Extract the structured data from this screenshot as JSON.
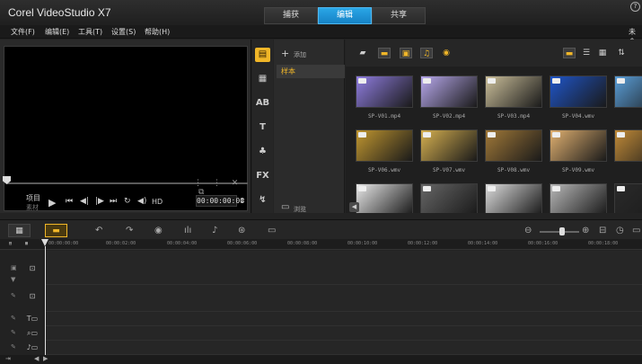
{
  "app": {
    "title": "Corel VideoStudio X7"
  },
  "mode_tabs": [
    {
      "label": "捕获",
      "active": false
    },
    {
      "label": "编辑",
      "active": true
    },
    {
      "label": "共享",
      "active": false
    }
  ],
  "menu": {
    "items": [
      "文件(F)",
      "编辑(E)",
      "工具(T)",
      "设置(S)",
      "帮助(H)"
    ],
    "right_label": "未命"
  },
  "player": {
    "project_label": "项目",
    "clip_label": "素材",
    "hd_label": "HD",
    "timecode": "00:00:00:00",
    "controls": [
      "play-icon",
      "home-icon",
      "prev-frame-icon",
      "next-frame-icon",
      "end-icon",
      "repeat-icon",
      "volume-icon"
    ]
  },
  "library": {
    "add_label": "添加",
    "browse_label": "浏览",
    "folders": [
      {
        "label": "样本",
        "selected": true
      }
    ],
    "side_tools": [
      "media-icon",
      "instant-project-icon",
      "transition-icon",
      "title-icon",
      "graphic-icon",
      "filter-icon",
      "path-icon"
    ],
    "toolbar_icons": [
      "folder-icon",
      "show-videos-icon",
      "show-photos-icon",
      "show-audio-icon",
      "show-effects-icon"
    ],
    "view_icons": [
      "thumbnail-view-icon",
      "list-view-icon",
      "grid-view-icon",
      "options-icon"
    ],
    "thumbnails": [
      {
        "caption": "SP-V01.mp4",
        "color": "#8f7de0"
      },
      {
        "caption": "SP-V02.mp4",
        "color": "#b7a8ec"
      },
      {
        "caption": "SP-V03.mp4",
        "color": "#cbbf9a"
      },
      {
        "caption": "SP-V04.wmv",
        "color": "#1f55c8"
      },
      {
        "caption": "",
        "color": "#5a9ed8"
      },
      {
        "caption": "SP-V06.wmv",
        "color": "#c09630"
      },
      {
        "caption": "SP-V07.wmv",
        "color": "#d6b050"
      },
      {
        "caption": "SP-V08.wmv",
        "color": "#a07838"
      },
      {
        "caption": "SP-V09.wmv",
        "color": "#e0b070"
      },
      {
        "caption": "",
        "color": "#c08a38"
      },
      {
        "caption": "",
        "color": "#e8e8e8"
      },
      {
        "caption": "",
        "color": "#666666"
      },
      {
        "caption": "",
        "color": "#dcdcdc"
      },
      {
        "caption": "",
        "color": "#b8b8b8"
      },
      {
        "caption": "",
        "color": "#2a2a2a"
      }
    ]
  },
  "timeline": {
    "view_buttons": [
      {
        "icon": "storyboard-view-icon",
        "active": false
      },
      {
        "icon": "timeline-view-icon",
        "active": true
      }
    ],
    "tools": [
      "undo-icon",
      "redo-icon",
      "record-capture-icon",
      "sound-mixer-icon",
      "auto-music-icon",
      "motion-tracking-icon",
      "subtitle-editor-icon"
    ],
    "right_tools": [
      "zoom-out-icon",
      "zoom-in-icon",
      "fit-project-icon",
      "project-duration-icon"
    ],
    "ruler_labels": [
      "00:00:00:00",
      "00:00:02:00",
      "00:00:04:00",
      "00:00:06:00",
      "00:00:08:00",
      "00:00:10:00",
      "00:00:12:00",
      "00:00:14:00",
      "00:00:16:00",
      "00:00:18:00"
    ],
    "tracks": [
      "video-track-icon",
      "overlay-track-icon",
      "title-track-icon",
      "voice-track-icon",
      "music-track-icon"
    ]
  }
}
